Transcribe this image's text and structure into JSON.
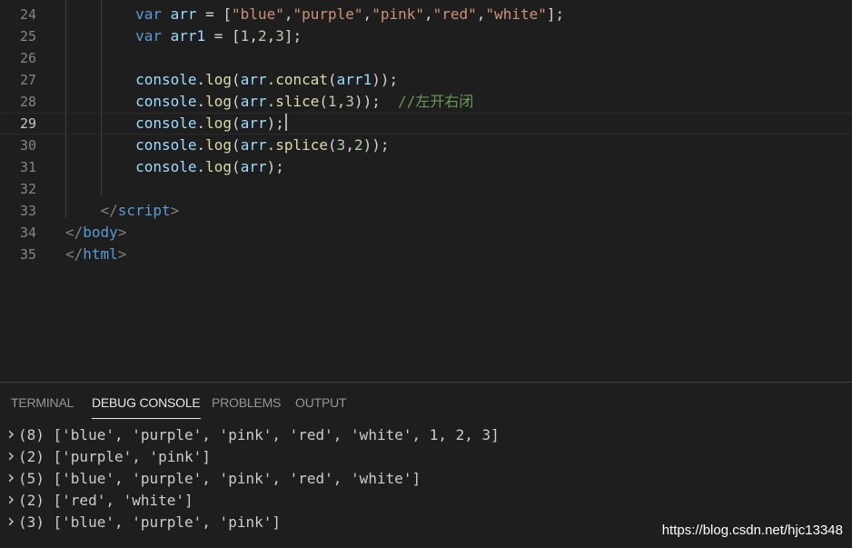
{
  "editor": {
    "current_line": "29",
    "lines": [
      {
        "num": "24",
        "indent": "        ",
        "tokens": [
          {
            "t": "var",
            "c": "kw"
          },
          {
            "t": " "
          },
          {
            "t": "arr",
            "c": "var"
          },
          {
            "t": " = ["
          },
          {
            "t": "\"blue\"",
            "c": "str"
          },
          {
            "t": ","
          },
          {
            "t": "\"purple\"",
            "c": "str"
          },
          {
            "t": ","
          },
          {
            "t": "\"pink\"",
            "c": "str"
          },
          {
            "t": ","
          },
          {
            "t": "\"red\"",
            "c": "str"
          },
          {
            "t": ","
          },
          {
            "t": "\"white\"",
            "c": "str"
          },
          {
            "t": "];"
          }
        ]
      },
      {
        "num": "25",
        "indent": "        ",
        "tokens": [
          {
            "t": "var",
            "c": "kw"
          },
          {
            "t": " "
          },
          {
            "t": "arr1",
            "c": "var"
          },
          {
            "t": " = ["
          },
          {
            "t": "1",
            "c": "num"
          },
          {
            "t": ","
          },
          {
            "t": "2",
            "c": "num"
          },
          {
            "t": ","
          },
          {
            "t": "3",
            "c": "num"
          },
          {
            "t": "];"
          }
        ]
      },
      {
        "num": "26",
        "indent": "",
        "tokens": []
      },
      {
        "num": "27",
        "indent": "        ",
        "tokens": [
          {
            "t": "console",
            "c": "var"
          },
          {
            "t": "."
          },
          {
            "t": "log",
            "c": "fn"
          },
          {
            "t": "("
          },
          {
            "t": "arr",
            "c": "var"
          },
          {
            "t": "."
          },
          {
            "t": "concat",
            "c": "fn"
          },
          {
            "t": "("
          },
          {
            "t": "arr1",
            "c": "var"
          },
          {
            "t": "));"
          }
        ]
      },
      {
        "num": "28",
        "indent": "        ",
        "tokens": [
          {
            "t": "console",
            "c": "var"
          },
          {
            "t": "."
          },
          {
            "t": "log",
            "c": "fn"
          },
          {
            "t": "("
          },
          {
            "t": "arr",
            "c": "var"
          },
          {
            "t": "."
          },
          {
            "t": "slice",
            "c": "fn"
          },
          {
            "t": "("
          },
          {
            "t": "1",
            "c": "num"
          },
          {
            "t": ","
          },
          {
            "t": "3",
            "c": "num"
          },
          {
            "t": "));  "
          },
          {
            "t": "//左开右闭",
            "c": "cmt"
          }
        ]
      },
      {
        "num": "29",
        "indent": "        ",
        "cursor": true,
        "tokens": [
          {
            "t": "console",
            "c": "var"
          },
          {
            "t": "."
          },
          {
            "t": "log",
            "c": "fn"
          },
          {
            "t": "("
          },
          {
            "t": "arr",
            "c": "var"
          },
          {
            "t": ");"
          }
        ]
      },
      {
        "num": "30",
        "indent": "        ",
        "tokens": [
          {
            "t": "console",
            "c": "var"
          },
          {
            "t": "."
          },
          {
            "t": "log",
            "c": "fn"
          },
          {
            "t": "("
          },
          {
            "t": "arr",
            "c": "var"
          },
          {
            "t": "."
          },
          {
            "t": "splice",
            "c": "fn"
          },
          {
            "t": "("
          },
          {
            "t": "3",
            "c": "num"
          },
          {
            "t": ","
          },
          {
            "t": "2",
            "c": "num"
          },
          {
            "t": "));"
          }
        ]
      },
      {
        "num": "31",
        "indent": "        ",
        "tokens": [
          {
            "t": "console",
            "c": "var"
          },
          {
            "t": "."
          },
          {
            "t": "log",
            "c": "fn"
          },
          {
            "t": "("
          },
          {
            "t": "arr",
            "c": "var"
          },
          {
            "t": ");"
          }
        ]
      },
      {
        "num": "32",
        "indent": "",
        "tokens": []
      },
      {
        "num": "33",
        "indent": "    ",
        "tokens": [
          {
            "t": "</",
            "c": "punc"
          },
          {
            "t": "script",
            "c": "tag"
          },
          {
            "t": ">",
            "c": "punc"
          }
        ]
      },
      {
        "num": "34",
        "indent": "",
        "tokens": [
          {
            "t": "</",
            "c": "punc"
          },
          {
            "t": "body",
            "c": "tag"
          },
          {
            "t": ">",
            "c": "punc"
          }
        ]
      },
      {
        "num": "35",
        "indent": "",
        "tokens": [
          {
            "t": "</",
            "c": "punc"
          },
          {
            "t": "html",
            "c": "tag"
          },
          {
            "t": ">",
            "c": "punc"
          }
        ]
      }
    ]
  },
  "panel": {
    "tabs": [
      {
        "label": "TERMINAL",
        "active": false
      },
      {
        "label": "DEBUG CONSOLE",
        "active": true
      },
      {
        "label": "PROBLEMS",
        "active": false
      },
      {
        "label": "OUTPUT",
        "active": false
      }
    ],
    "output": [
      {
        "count": "(8)",
        "value": "['blue', 'purple', 'pink', 'red', 'white', 1, 2, 3]"
      },
      {
        "count": "(2)",
        "value": "['purple', 'pink']"
      },
      {
        "count": "(5)",
        "value": "['blue', 'purple', 'pink', 'red', 'white']"
      },
      {
        "count": "(2)",
        "value": "['red', 'white']"
      },
      {
        "count": "(3)",
        "value": "['blue', 'purple', 'pink']"
      }
    ]
  },
  "watermark": "https://blog.csdn.net/hjc13348",
  "icons": {
    "expand": "chevron-right-icon"
  },
  "colors": {
    "background": "#1e1e1e",
    "keyword": "#569cd6",
    "string": "#ce9178",
    "number": "#b5cea8",
    "function": "#dcdcaa",
    "comment": "#6a9955",
    "variable": "#9cdcfe"
  }
}
